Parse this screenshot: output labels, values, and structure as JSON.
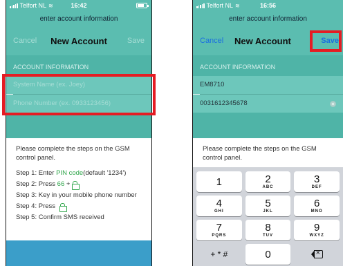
{
  "left": {
    "status": {
      "carrier": "Telfort NL",
      "time": "16:42"
    },
    "prompt": "enter account information",
    "nav": {
      "cancel": "Cancel",
      "title": "New Account",
      "save": "Save"
    },
    "section_header": "ACCOUNT INFORMATION",
    "system_name_placeholder": "System Name (ex. Joey)",
    "phone_placeholder": "Phone Number (ex. 0933123456)",
    "instructions": {
      "intro": "Please complete the steps on the GSM control panel.",
      "step1_pre": "Step 1: Enter ",
      "step1_pin": "PIN code",
      "step1_post": " (default '1234')",
      "step2_pre": "Step 2: Press ",
      "step2_code": "66",
      "step2_post": " + ",
      "step3": "Step 3: Key in your mobile phone number",
      "step4_pre": "Step 4: Press ",
      "step5": "Step 5: Confirm SMS received"
    }
  },
  "right": {
    "status": {
      "carrier": "Telfort NL",
      "time": "16:56"
    },
    "prompt": "enter account information",
    "nav": {
      "cancel": "Cancel",
      "title": "New Account",
      "save": "Save"
    },
    "section_header": "ACCOUNT INFORMATION",
    "system_name_value": "EM8710",
    "phone_value": "0031612345678",
    "instructions": {
      "intro": "Please complete the steps on the GSM control panel."
    },
    "keyboard": {
      "keys": [
        {
          "digit": "1",
          "letters": ""
        },
        {
          "digit": "2",
          "letters": "ABC"
        },
        {
          "digit": "3",
          "letters": "DEF"
        },
        {
          "digit": "4",
          "letters": "GHI"
        },
        {
          "digit": "5",
          "letters": "JKL"
        },
        {
          "digit": "6",
          "letters": "MNO"
        },
        {
          "digit": "7",
          "letters": "PQRS"
        },
        {
          "digit": "8",
          "letters": "TUV"
        },
        {
          "digit": "9",
          "letters": "WXYZ"
        }
      ],
      "symbols": "+ * #",
      "zero": "0"
    }
  },
  "colors": {
    "teal": "#5bbdb0",
    "teal_dark": "#4fb4a7",
    "highlight_red": "#e51c23",
    "save_blue": "#1a6fe0",
    "inactive_text": "#a6ddd5",
    "footer_blue": "#3b9ec9",
    "accent_green": "#2fa54a"
  },
  "icons": [
    "signal-icon",
    "wifi-icon",
    "battery-icon",
    "lock-icon",
    "clear-icon",
    "backspace-icon"
  ]
}
